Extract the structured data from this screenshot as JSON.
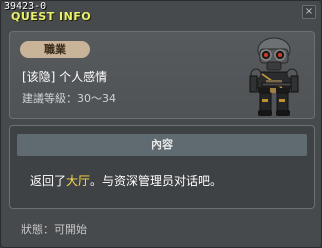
{
  "window": {
    "id_label": "39423-0",
    "title": "QUEST INFO",
    "close_symbol": "×"
  },
  "info": {
    "job_badge": "職業",
    "quest_name": "[该隐] 个人感情",
    "level_requirement": "建議等級：30～34",
    "npc_icon": "armored-soldier-avatar"
  },
  "content": {
    "header": "內容",
    "text_before": "返回了",
    "text_highlight": "大厅",
    "text_after": "。与资深管理员对话吧。"
  },
  "status": {
    "text": "狀態：可開始"
  },
  "colors": {
    "title": "#e8f070",
    "highlight": "#ffd84a",
    "badge": "#c9b49a"
  }
}
